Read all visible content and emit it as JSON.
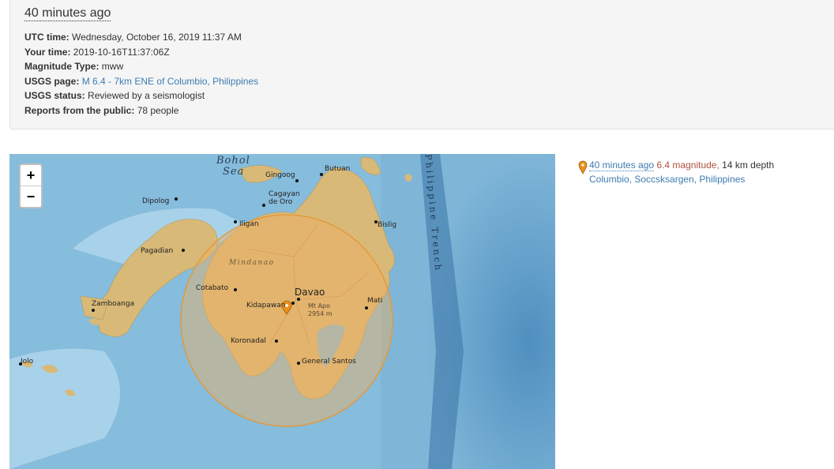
{
  "header": {
    "time_ago": "40 minutes ago"
  },
  "details": {
    "utc_label": "UTC time:",
    "utc_value": "Wednesday, October 16, 2019 11:37 AM",
    "your_time_label": "Your time:",
    "your_time_value": "2019-10-16T11:37:06Z",
    "mag_type_label": "Magnitude Type:",
    "mag_type_value": "mww",
    "usgs_page_label": "USGS page:",
    "usgs_page_link": "M 6.4 - 7km ENE of Columbio, Philippines",
    "usgs_status_label": "USGS status:",
    "usgs_status_value": "Reviewed by a seismologist",
    "reports_label": "Reports from the public:",
    "reports_value": "78 people"
  },
  "map": {
    "zoom_in": "+",
    "zoom_out": "−",
    "labels": {
      "bohol_sea_1": "Bohol",
      "bohol_sea_2": "Sea",
      "gingoog": "Gingoog",
      "butuan": "Butuan",
      "cagayan_1": "Cagayan",
      "cagayan_2": "de Oro",
      "dipolog": "Dipolog",
      "iligan": "Iligan",
      "bislig": "Bislig",
      "pagadian": "Pagadian",
      "mindanao": "Mindanao",
      "cotabato": "Cotabato",
      "davao": "Davao",
      "mati": "Mati",
      "zamboanga": "Zamboanga",
      "kidapawan": "Kidapawan",
      "mt_apo_1": "Mt Apo",
      "mt_apo_2": "2954 m",
      "koronadal": "Koronadal",
      "general_santos": "General Santos",
      "jolo": "Jolo",
      "trench": "Philippine Trench"
    },
    "colors": {
      "sea": "#7fb6d8",
      "land": "#d9b978",
      "radius_fill": "#f0b060",
      "radius_stroke": "#e29a3c",
      "pin": "#e8901c"
    }
  },
  "sidebar": {
    "time_ago": "40 minutes ago",
    "magnitude": "6.4 magnitude,",
    "depth": "14 km depth",
    "location": "Columbio, Soccsksargen, Philippines"
  }
}
